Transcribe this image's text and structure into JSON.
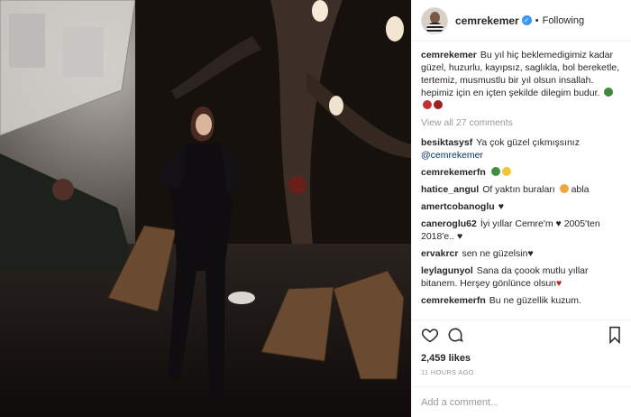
{
  "post": {
    "username": "cemrekemer",
    "follow_separator": "•",
    "follow_status": "Following",
    "caption": "Bu yıl hiç beklemedigimiz kadar güzel, huzurlu, kayıpsız, saglıkla, bol bereketle, tertemiz, musmustlu bir yıl olsun insallah. hepimiz için en içten şekilde dilegim budur.",
    "view_all": "View all 27 comments"
  },
  "comments": [
    {
      "user": "besiktasysf",
      "text": "Ya çok güzel çıkmışsınız",
      "mention": "@cemrekemer"
    },
    {
      "user": "cemrekemerfn",
      "text": ""
    },
    {
      "user": "hatice_angul",
      "text": "Of yaktın buraları",
      "suffix": "abla"
    },
    {
      "user": "amertcobanoglu",
      "text": ""
    },
    {
      "user": "caneroglu62",
      "text": "İyi yıllar Cemre'm",
      "suffix": "2005'ten 2018'e.."
    },
    {
      "user": "ervakrcr",
      "text": "sen ne güzelsin"
    },
    {
      "user": "leylagunyol",
      "text": "Sana da çoook mutlu yıllar bitanem. Herşey gönlünce olsun"
    },
    {
      "user": "cemrekemerfn",
      "text": "Bu ne güzellik kuzum."
    }
  ],
  "actions": {
    "likes": "2,459 likes",
    "timestamp": "11 HOURS AGO",
    "add_comment_placeholder": "Add a comment..."
  },
  "icons": [
    "heart-icon",
    "comment-icon",
    "bookmark-icon",
    "verified-icon"
  ],
  "colors": {
    "verified": "#3897f0",
    "mention": "#003569",
    "muted": "#999999"
  }
}
